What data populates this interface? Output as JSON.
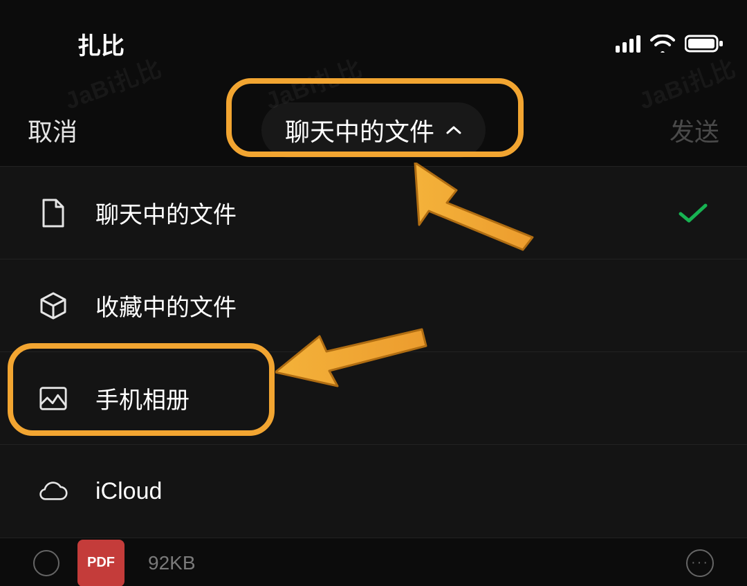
{
  "status": {
    "title": "扎比"
  },
  "nav": {
    "cancel": "取消",
    "title": "聊天中的文件",
    "send": "发送"
  },
  "menu": {
    "items": [
      {
        "label": "聊天中的文件",
        "selected": true
      },
      {
        "label": "收藏中的文件",
        "selected": false
      },
      {
        "label": "手机相册",
        "selected": false
      },
      {
        "label": "iCloud",
        "selected": false
      }
    ]
  },
  "file": {
    "badge": "PDF",
    "size": "92KB"
  },
  "watermark": "JaBi扎比"
}
